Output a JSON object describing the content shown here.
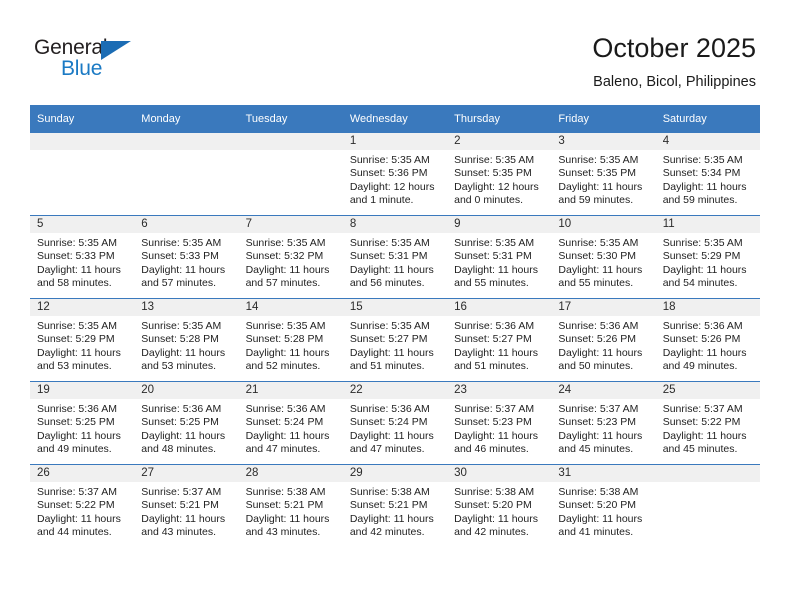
{
  "brand": {
    "name_top": "General",
    "name_bottom": "Blue",
    "triangle_icon": "triangle-icon",
    "color_dark": "#231f20",
    "color_blue": "#1b7ac4"
  },
  "header": {
    "title": "October 2025",
    "subtitle": "Baleno, Bicol, Philippines"
  },
  "colors": {
    "header_band": "#3a79bd",
    "daynum_band": "#f0f0f0",
    "text": "#1f1f1f"
  },
  "calendar": {
    "weekday_headers": [
      "Sunday",
      "Monday",
      "Tuesday",
      "Wednesday",
      "Thursday",
      "Friday",
      "Saturday"
    ],
    "weeks": [
      [
        {
          "day": "",
          "empty": true,
          "sunrise": "",
          "sunset": "",
          "daylight_line1": "",
          "daylight_line2": ""
        },
        {
          "day": "",
          "empty": true,
          "sunrise": "",
          "sunset": "",
          "daylight_line1": "",
          "daylight_line2": ""
        },
        {
          "day": "",
          "empty": true,
          "sunrise": "",
          "sunset": "",
          "daylight_line1": "",
          "daylight_line2": ""
        },
        {
          "day": "1",
          "empty": false,
          "sunrise": "Sunrise: 5:35 AM",
          "sunset": "Sunset: 5:36 PM",
          "daylight_line1": "Daylight: 12 hours",
          "daylight_line2": "and 1 minute."
        },
        {
          "day": "2",
          "empty": false,
          "sunrise": "Sunrise: 5:35 AM",
          "sunset": "Sunset: 5:35 PM",
          "daylight_line1": "Daylight: 12 hours",
          "daylight_line2": "and 0 minutes."
        },
        {
          "day": "3",
          "empty": false,
          "sunrise": "Sunrise: 5:35 AM",
          "sunset": "Sunset: 5:35 PM",
          "daylight_line1": "Daylight: 11 hours",
          "daylight_line2": "and 59 minutes."
        },
        {
          "day": "4",
          "empty": false,
          "sunrise": "Sunrise: 5:35 AM",
          "sunset": "Sunset: 5:34 PM",
          "daylight_line1": "Daylight: 11 hours",
          "daylight_line2": "and 59 minutes."
        }
      ],
      [
        {
          "day": "5",
          "empty": false,
          "sunrise": "Sunrise: 5:35 AM",
          "sunset": "Sunset: 5:33 PM",
          "daylight_line1": "Daylight: 11 hours",
          "daylight_line2": "and 58 minutes."
        },
        {
          "day": "6",
          "empty": false,
          "sunrise": "Sunrise: 5:35 AM",
          "sunset": "Sunset: 5:33 PM",
          "daylight_line1": "Daylight: 11 hours",
          "daylight_line2": "and 57 minutes."
        },
        {
          "day": "7",
          "empty": false,
          "sunrise": "Sunrise: 5:35 AM",
          "sunset": "Sunset: 5:32 PM",
          "daylight_line1": "Daylight: 11 hours",
          "daylight_line2": "and 57 minutes."
        },
        {
          "day": "8",
          "empty": false,
          "sunrise": "Sunrise: 5:35 AM",
          "sunset": "Sunset: 5:31 PM",
          "daylight_line1": "Daylight: 11 hours",
          "daylight_line2": "and 56 minutes."
        },
        {
          "day": "9",
          "empty": false,
          "sunrise": "Sunrise: 5:35 AM",
          "sunset": "Sunset: 5:31 PM",
          "daylight_line1": "Daylight: 11 hours",
          "daylight_line2": "and 55 minutes."
        },
        {
          "day": "10",
          "empty": false,
          "sunrise": "Sunrise: 5:35 AM",
          "sunset": "Sunset: 5:30 PM",
          "daylight_line1": "Daylight: 11 hours",
          "daylight_line2": "and 55 minutes."
        },
        {
          "day": "11",
          "empty": false,
          "sunrise": "Sunrise: 5:35 AM",
          "sunset": "Sunset: 5:29 PM",
          "daylight_line1": "Daylight: 11 hours",
          "daylight_line2": "and 54 minutes."
        }
      ],
      [
        {
          "day": "12",
          "empty": false,
          "sunrise": "Sunrise: 5:35 AM",
          "sunset": "Sunset: 5:29 PM",
          "daylight_line1": "Daylight: 11 hours",
          "daylight_line2": "and 53 minutes."
        },
        {
          "day": "13",
          "empty": false,
          "sunrise": "Sunrise: 5:35 AM",
          "sunset": "Sunset: 5:28 PM",
          "daylight_line1": "Daylight: 11 hours",
          "daylight_line2": "and 53 minutes."
        },
        {
          "day": "14",
          "empty": false,
          "sunrise": "Sunrise: 5:35 AM",
          "sunset": "Sunset: 5:28 PM",
          "daylight_line1": "Daylight: 11 hours",
          "daylight_line2": "and 52 minutes."
        },
        {
          "day": "15",
          "empty": false,
          "sunrise": "Sunrise: 5:35 AM",
          "sunset": "Sunset: 5:27 PM",
          "daylight_line1": "Daylight: 11 hours",
          "daylight_line2": "and 51 minutes."
        },
        {
          "day": "16",
          "empty": false,
          "sunrise": "Sunrise: 5:36 AM",
          "sunset": "Sunset: 5:27 PM",
          "daylight_line1": "Daylight: 11 hours",
          "daylight_line2": "and 51 minutes."
        },
        {
          "day": "17",
          "empty": false,
          "sunrise": "Sunrise: 5:36 AM",
          "sunset": "Sunset: 5:26 PM",
          "daylight_line1": "Daylight: 11 hours",
          "daylight_line2": "and 50 minutes."
        },
        {
          "day": "18",
          "empty": false,
          "sunrise": "Sunrise: 5:36 AM",
          "sunset": "Sunset: 5:26 PM",
          "daylight_line1": "Daylight: 11 hours",
          "daylight_line2": "and 49 minutes."
        }
      ],
      [
        {
          "day": "19",
          "empty": false,
          "sunrise": "Sunrise: 5:36 AM",
          "sunset": "Sunset: 5:25 PM",
          "daylight_line1": "Daylight: 11 hours",
          "daylight_line2": "and 49 minutes."
        },
        {
          "day": "20",
          "empty": false,
          "sunrise": "Sunrise: 5:36 AM",
          "sunset": "Sunset: 5:25 PM",
          "daylight_line1": "Daylight: 11 hours",
          "daylight_line2": "and 48 minutes."
        },
        {
          "day": "21",
          "empty": false,
          "sunrise": "Sunrise: 5:36 AM",
          "sunset": "Sunset: 5:24 PM",
          "daylight_line1": "Daylight: 11 hours",
          "daylight_line2": "and 47 minutes."
        },
        {
          "day": "22",
          "empty": false,
          "sunrise": "Sunrise: 5:36 AM",
          "sunset": "Sunset: 5:24 PM",
          "daylight_line1": "Daylight: 11 hours",
          "daylight_line2": "and 47 minutes."
        },
        {
          "day": "23",
          "empty": false,
          "sunrise": "Sunrise: 5:37 AM",
          "sunset": "Sunset: 5:23 PM",
          "daylight_line1": "Daylight: 11 hours",
          "daylight_line2": "and 46 minutes."
        },
        {
          "day": "24",
          "empty": false,
          "sunrise": "Sunrise: 5:37 AM",
          "sunset": "Sunset: 5:23 PM",
          "daylight_line1": "Daylight: 11 hours",
          "daylight_line2": "and 45 minutes."
        },
        {
          "day": "25",
          "empty": false,
          "sunrise": "Sunrise: 5:37 AM",
          "sunset": "Sunset: 5:22 PM",
          "daylight_line1": "Daylight: 11 hours",
          "daylight_line2": "and 45 minutes."
        }
      ],
      [
        {
          "day": "26",
          "empty": false,
          "sunrise": "Sunrise: 5:37 AM",
          "sunset": "Sunset: 5:22 PM",
          "daylight_line1": "Daylight: 11 hours",
          "daylight_line2": "and 44 minutes."
        },
        {
          "day": "27",
          "empty": false,
          "sunrise": "Sunrise: 5:37 AM",
          "sunset": "Sunset: 5:21 PM",
          "daylight_line1": "Daylight: 11 hours",
          "daylight_line2": "and 43 minutes."
        },
        {
          "day": "28",
          "empty": false,
          "sunrise": "Sunrise: 5:38 AM",
          "sunset": "Sunset: 5:21 PM",
          "daylight_line1": "Daylight: 11 hours",
          "daylight_line2": "and 43 minutes."
        },
        {
          "day": "29",
          "empty": false,
          "sunrise": "Sunrise: 5:38 AM",
          "sunset": "Sunset: 5:21 PM",
          "daylight_line1": "Daylight: 11 hours",
          "daylight_line2": "and 42 minutes."
        },
        {
          "day": "30",
          "empty": false,
          "sunrise": "Sunrise: 5:38 AM",
          "sunset": "Sunset: 5:20 PM",
          "daylight_line1": "Daylight: 11 hours",
          "daylight_line2": "and 42 minutes."
        },
        {
          "day": "31",
          "empty": false,
          "sunrise": "Sunrise: 5:38 AM",
          "sunset": "Sunset: 5:20 PM",
          "daylight_line1": "Daylight: 11 hours",
          "daylight_line2": "and 41 minutes."
        },
        {
          "day": "",
          "empty": true,
          "sunrise": "",
          "sunset": "",
          "daylight_line1": "",
          "daylight_line2": ""
        }
      ]
    ]
  }
}
